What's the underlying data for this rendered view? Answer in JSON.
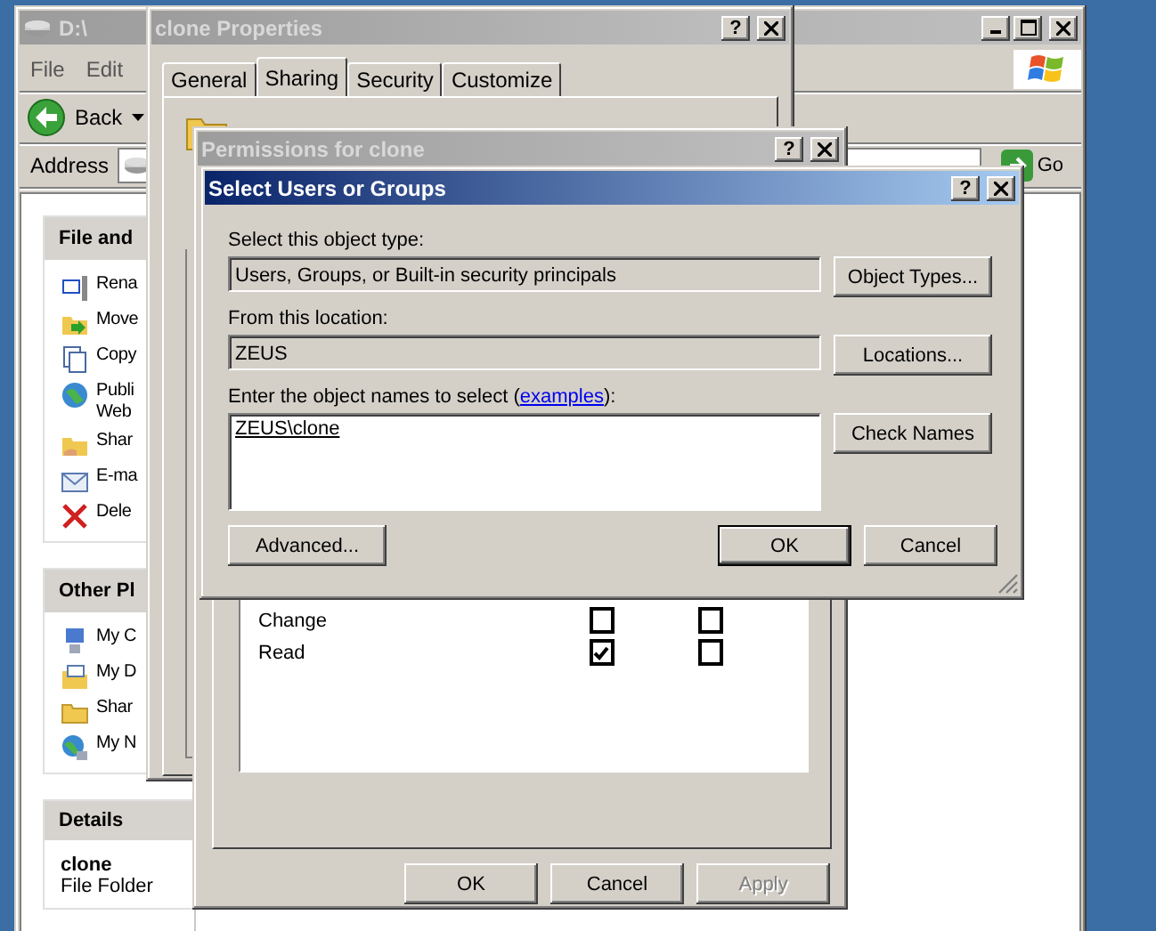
{
  "explorer": {
    "title": "D:\\",
    "menu": [
      "File",
      "Edit"
    ],
    "back": "Back",
    "address_label": "Address",
    "go": "Go",
    "panes": [
      {
        "kind": "tasks",
        "title": "File and",
        "items": [
          {
            "kind": "rename",
            "lines": [
              "Rena"
            ]
          },
          {
            "kind": "move",
            "lines": [
              "Move"
            ]
          },
          {
            "kind": "copy",
            "lines": [
              "Copy"
            ]
          },
          {
            "kind": "publish",
            "lines": [
              "Publi",
              "Web"
            ]
          },
          {
            "kind": "share",
            "lines": [
              "Shar"
            ]
          },
          {
            "kind": "email",
            "lines": [
              "E-ma"
            ]
          },
          {
            "kind": "delete",
            "lines": [
              "Dele"
            ]
          }
        ]
      },
      {
        "kind": "tasks",
        "title": "Other Pl",
        "items": [
          {
            "kind": "computer",
            "lines": [
              "My C"
            ]
          },
          {
            "kind": "documents",
            "lines": [
              "My D"
            ]
          },
          {
            "kind": "folder",
            "lines": [
              "Shar"
            ]
          },
          {
            "kind": "network",
            "lines": [
              "My N"
            ]
          }
        ]
      },
      {
        "kind": "details",
        "title": "Details",
        "name": "clone",
        "type": "File Folder"
      }
    ]
  },
  "properties": {
    "title": "clone Properties",
    "help": "?",
    "tabs": [
      {
        "label": "General",
        "selected": false
      },
      {
        "label": "Sharing",
        "selected": true
      },
      {
        "label": "Security",
        "selected": false
      },
      {
        "label": "Customize",
        "selected": false
      }
    ]
  },
  "permissions": {
    "title": "Permissions for clone",
    "help": "?",
    "rows": [
      {
        "label": "Change",
        "allow": false,
        "deny": false
      },
      {
        "label": "Read",
        "allow": true,
        "deny": false
      }
    ],
    "buttons": [
      {
        "label": "OK",
        "disabled": false
      },
      {
        "label": "Cancel",
        "disabled": false
      },
      {
        "label": "Apply",
        "disabled": true
      }
    ]
  },
  "select": {
    "title": "Select Users or Groups",
    "help": "?",
    "fields": [
      {
        "label": "Select this object type:",
        "value": "Users, Groups, or Built-in security principals",
        "button": "Object Types..."
      },
      {
        "label": "From this location:",
        "value": "ZEUS",
        "button": "Locations..."
      }
    ],
    "names": {
      "label_before": "Enter the object names to select (",
      "link": "examples",
      "label_after": "):",
      "value": "ZEUS\\clone",
      "button": "Check Names"
    },
    "advanced": "Advanced...",
    "ok": "OK",
    "cancel": "Cancel"
  }
}
